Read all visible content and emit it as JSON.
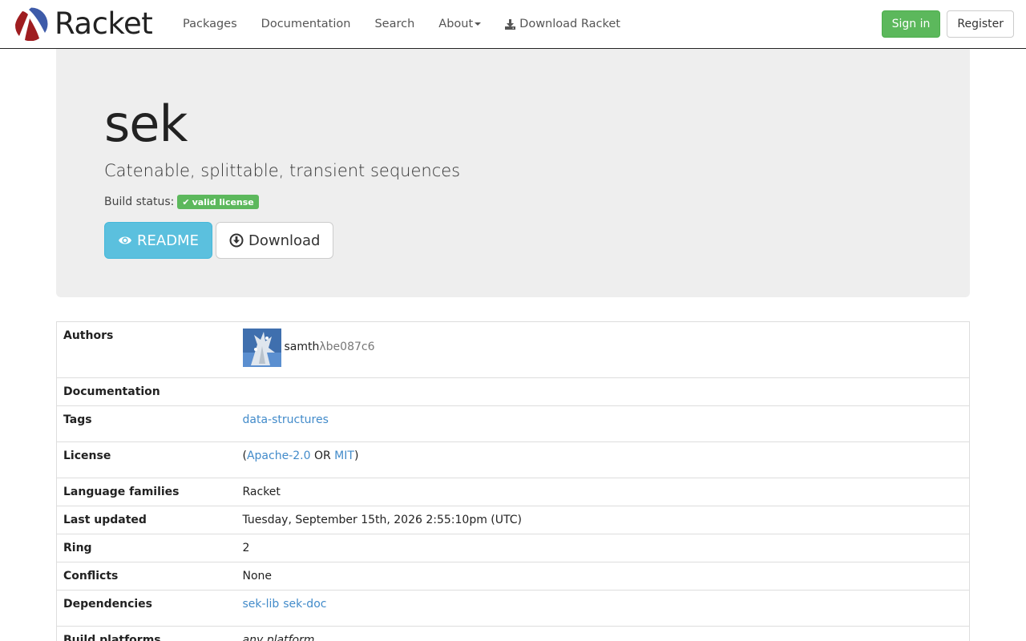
{
  "brand": {
    "name": "Racket"
  },
  "nav": {
    "packages": "Packages",
    "documentation": "Documentation",
    "search": "Search",
    "about": "About",
    "download": "Download Racket"
  },
  "auth": {
    "sign_in": "Sign in",
    "register": "Register"
  },
  "package": {
    "title": "sek",
    "description": "Catenable, splittable, transient sequences",
    "build_status_label": "Build status:",
    "badge": "valid license",
    "readme_button": "README",
    "download_button": "Download"
  },
  "details": {
    "authors_label": "Authors",
    "author_name": "samth",
    "author_hash": "λbe087c6",
    "documentation_label": "Documentation",
    "tags_label": "Tags",
    "tag": "data-structures",
    "license_label": "License",
    "license_open": "(",
    "license_a": "Apache-2.0",
    "license_or": " OR ",
    "license_b": "MIT",
    "license_close": ")",
    "language_label": "Language families",
    "language_value": "Racket",
    "updated_label": "Last updated",
    "updated_value": "Tuesday, September 15th, 2026 2:55:10pm (UTC)",
    "ring_label": "Ring",
    "ring_value": "2",
    "conflicts_label": "Conflicts",
    "conflicts_value": "None",
    "deps_label": "Dependencies",
    "deps": [
      "sek-lib",
      "sek-doc"
    ],
    "platforms_label": "Build platforms",
    "platforms_value": "any platform"
  },
  "colors": {
    "success": "#5cb85c",
    "info": "#5bc0de",
    "link": "#428bca",
    "jumbotron": "#eeeeee"
  }
}
